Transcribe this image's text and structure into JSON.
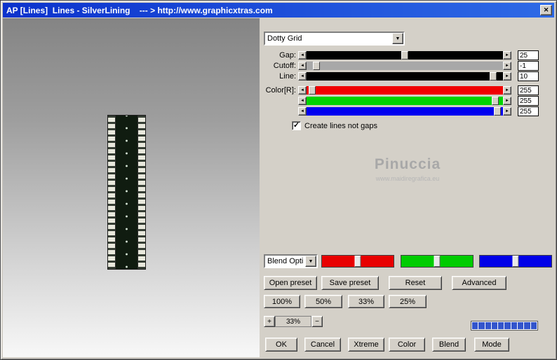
{
  "titlebar": {
    "title": "AP [Lines]  Lines - SilverLining    --- > http://www.graphicxtras.com"
  },
  "icons": {
    "close": "✕",
    "dropdown": "▼",
    "left_arrow": "◄",
    "right_arrow": "►",
    "check": "✓"
  },
  "preset": {
    "selected": "Dotty Grid"
  },
  "sliders": {
    "rows": [
      {
        "label": "Gap:",
        "value": "25",
        "track_color": "#000000",
        "thumb_pct": 50
      },
      {
        "label": "Cutoff:",
        "value": "-1",
        "track_color": "#a8a8a8",
        "thumb_pct": 5
      },
      {
        "label": "Line:",
        "value": "10",
        "track_color": "#000000",
        "thumb_pct": 95
      },
      {
        "label": "Color[R]:",
        "value": "255",
        "track_color": "#f00000",
        "thumb_pct": 3
      },
      {
        "label": "",
        "value": "255",
        "track_color": "#00d400",
        "thumb_pct": 96
      },
      {
        "label": "",
        "value": "255",
        "track_color": "#0000f0",
        "thumb_pct": 97
      }
    ]
  },
  "options": {
    "create_lines_label": "Create lines not gaps",
    "create_lines_checked": true
  },
  "watermark": {
    "name": "Pinuccia",
    "site": "www.maidiregrafica.eu"
  },
  "blend": {
    "dropdown_label": "Blend Opti",
    "tracks": [
      {
        "name": "red",
        "color": "#e80000"
      },
      {
        "name": "green",
        "color": "#00cc00"
      },
      {
        "name": "blue",
        "color": "#0000e8"
      }
    ]
  },
  "preset_buttons": {
    "open": "Open preset",
    "save": "Save preset",
    "reset": "Reset",
    "advanced": "Advanced"
  },
  "zoom_buttons": [
    "100%",
    "50%",
    "33%",
    "25%"
  ],
  "zoom_control": {
    "plus": "+",
    "value": "33%",
    "minus": "−"
  },
  "progress": {
    "segments": 10,
    "color": "#3355cc"
  },
  "action_buttons": [
    "OK",
    "Cancel",
    "Xtreme",
    "Color",
    "Blend",
    "Mode"
  ]
}
